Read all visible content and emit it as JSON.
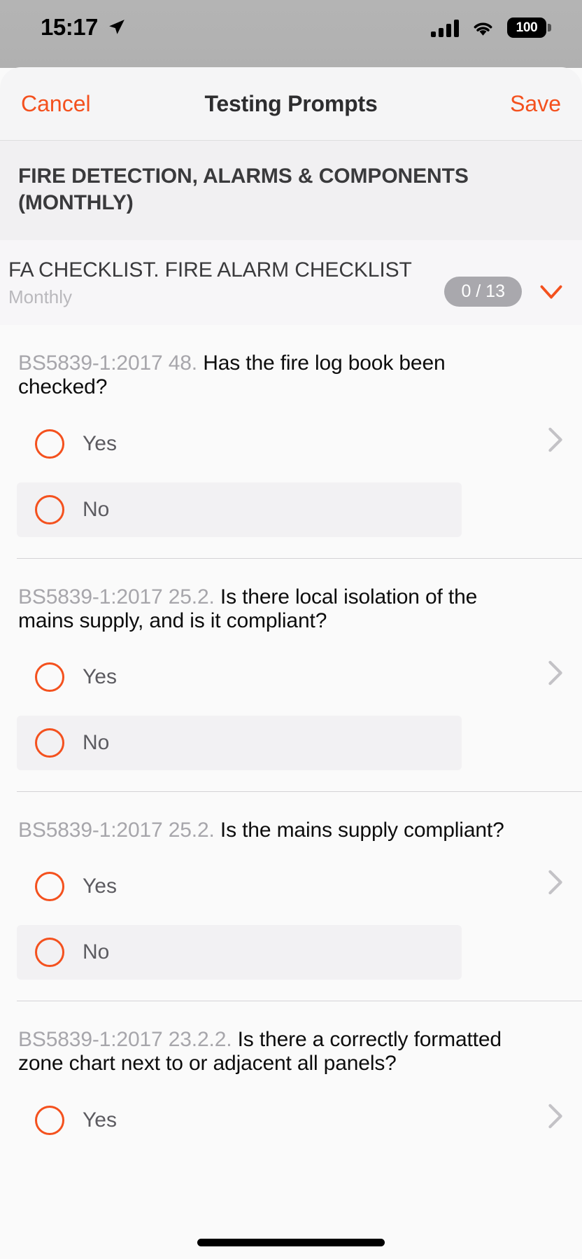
{
  "status_bar": {
    "time": "15:17",
    "location_icon": "location-arrow-icon",
    "cellular_icon": "cellular-signal-icon",
    "wifi_icon": "wifi-icon",
    "battery_percent": "100"
  },
  "nav": {
    "cancel_label": "Cancel",
    "title": "Testing Prompts",
    "save_label": "Save",
    "accent_color": "#f4511e"
  },
  "group": {
    "title": "FIRE DETECTION, ALARMS & COMPONENTS (MONTHLY)"
  },
  "checklist": {
    "title": "FA CHECKLIST. FIRE ALARM CHECKLIST",
    "subtitle": "Monthly",
    "progress_badge": "0 / 13",
    "badge_color": "#a9a8ad",
    "expand_icon": "chevron-down-icon"
  },
  "questions": [
    {
      "ref": "BS5839-1:2017 48.",
      "text": "Has the fire log book been checked?",
      "options": [
        {
          "label": "Yes",
          "selected": false
        },
        {
          "label": "No",
          "selected": false
        }
      ],
      "disclosure_icon": "chevron-right-icon"
    },
    {
      "ref": "BS5839-1:2017 25.2.",
      "text": "Is there local isolation of the mains supply, and is it compliant?",
      "options": [
        {
          "label": "Yes",
          "selected": false
        },
        {
          "label": "No",
          "selected": false
        }
      ],
      "disclosure_icon": "chevron-right-icon"
    },
    {
      "ref": "BS5839-1:2017 25.2.",
      "text": "Is the mains supply compliant?",
      "options": [
        {
          "label": "Yes",
          "selected": false
        },
        {
          "label": "No",
          "selected": false
        }
      ],
      "disclosure_icon": "chevron-right-icon"
    },
    {
      "ref": "BS5839-1:2017 23.2.2.",
      "text": "Is there a correctly formatted zone chart next to or adjacent all panels?",
      "options": [
        {
          "label": "Yes",
          "selected": false
        }
      ],
      "disclosure_icon": "chevron-right-icon"
    }
  ]
}
